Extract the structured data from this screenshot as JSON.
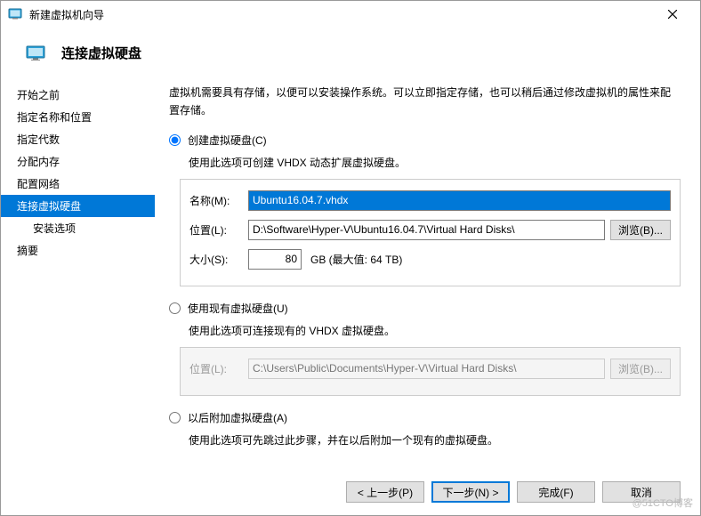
{
  "window": {
    "title": "新建虚拟机向导",
    "header": "连接虚拟硬盘"
  },
  "sidebar": {
    "items": [
      {
        "label": "开始之前"
      },
      {
        "label": "指定名称和位置"
      },
      {
        "label": "指定代数"
      },
      {
        "label": "分配内存"
      },
      {
        "label": "配置网络"
      },
      {
        "label": "连接虚拟硬盘"
      },
      {
        "label": "安装选项"
      },
      {
        "label": "摘要"
      }
    ]
  },
  "content": {
    "intro": "虚拟机需要具有存储，以便可以安装操作系统。可以立即指定存储，也可以稍后通过修改虚拟机的属性来配置存储。",
    "opt_create": {
      "label": "创建虚拟硬盘(C)",
      "desc": "使用此选项可创建 VHDX 动态扩展虚拟硬盘。",
      "name_label": "名称(M):",
      "name_value": "Ubuntu16.04.7.vhdx",
      "loc_label": "位置(L):",
      "loc_value": "D:\\Software\\Hyper-V\\Ubuntu16.04.7\\Virtual Hard Disks\\",
      "browse": "浏览(B)...",
      "size_label": "大小(S):",
      "size_value": "80",
      "size_unit": "GB (最大值: 64 TB)"
    },
    "opt_existing": {
      "label": "使用现有虚拟硬盘(U)",
      "desc": "使用此选项可连接现有的 VHDX 虚拟硬盘。",
      "loc_label": "位置(L):",
      "loc_value": "C:\\Users\\Public\\Documents\\Hyper-V\\Virtual Hard Disks\\",
      "browse": "浏览(B)..."
    },
    "opt_later": {
      "label": "以后附加虚拟硬盘(A)",
      "desc": "使用此选项可先跳过此步骤，并在以后附加一个现有的虚拟硬盘。"
    }
  },
  "buttons": {
    "back": "< 上一步(P)",
    "next": "下一步(N) >",
    "finish": "完成(F)",
    "cancel": "取消"
  },
  "watermark": "@51CTO博客"
}
